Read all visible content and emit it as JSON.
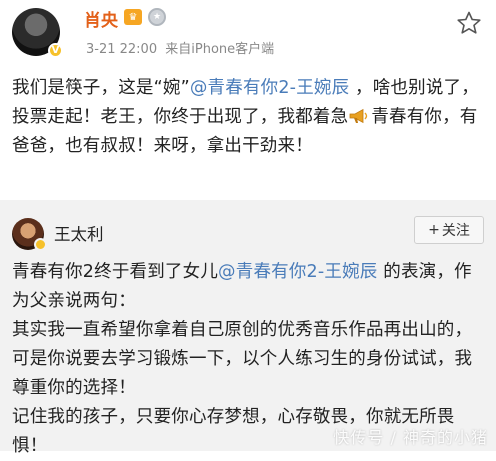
{
  "post": {
    "username": "肖央",
    "badge_crown": "♛",
    "badge_medal": "★",
    "avatar_verified": "V",
    "time": "3-21 22:00",
    "source": "来自iPhone客户端",
    "text_1": "我们是筷子，这是“婉”",
    "mention": "@青春有你2-王婉辰",
    "text_2": " ，啥也别说了，投票走起！老王，你终于出现了，我都着急",
    "text_3": "青春有你，有爸爸，也有叔叔！来呀，拿出干劲来！"
  },
  "repost": {
    "username": "王太利",
    "follow_label": "关注",
    "follow_plus": "+",
    "p1_a": "青春有你2终于看到了女儿",
    "p1_mention": "@青春有你2-王婉辰",
    "p1_b": " 的表演，作为父亲说两句：",
    "p2": "其实我一直希望你拿着自己原创的优秀音乐作品再出山的，可是你说要去学习锻炼一下，以个人练习生的身份试试，我尊重你的选择！",
    "p3": "记住我的孩子，只要你心存梦想，心存敬畏，你就无所畏惧！"
  },
  "watermark": "快传号 / 神奇的小猪",
  "colors": {
    "username": "#e3611a",
    "link": "#4a7cb9",
    "repost_bg": "#f2f2f2"
  },
  "icons": [
    "star-icon",
    "megaphone-icon",
    "verified-icon",
    "crown-badge-icon",
    "medal-badge-icon"
  ]
}
